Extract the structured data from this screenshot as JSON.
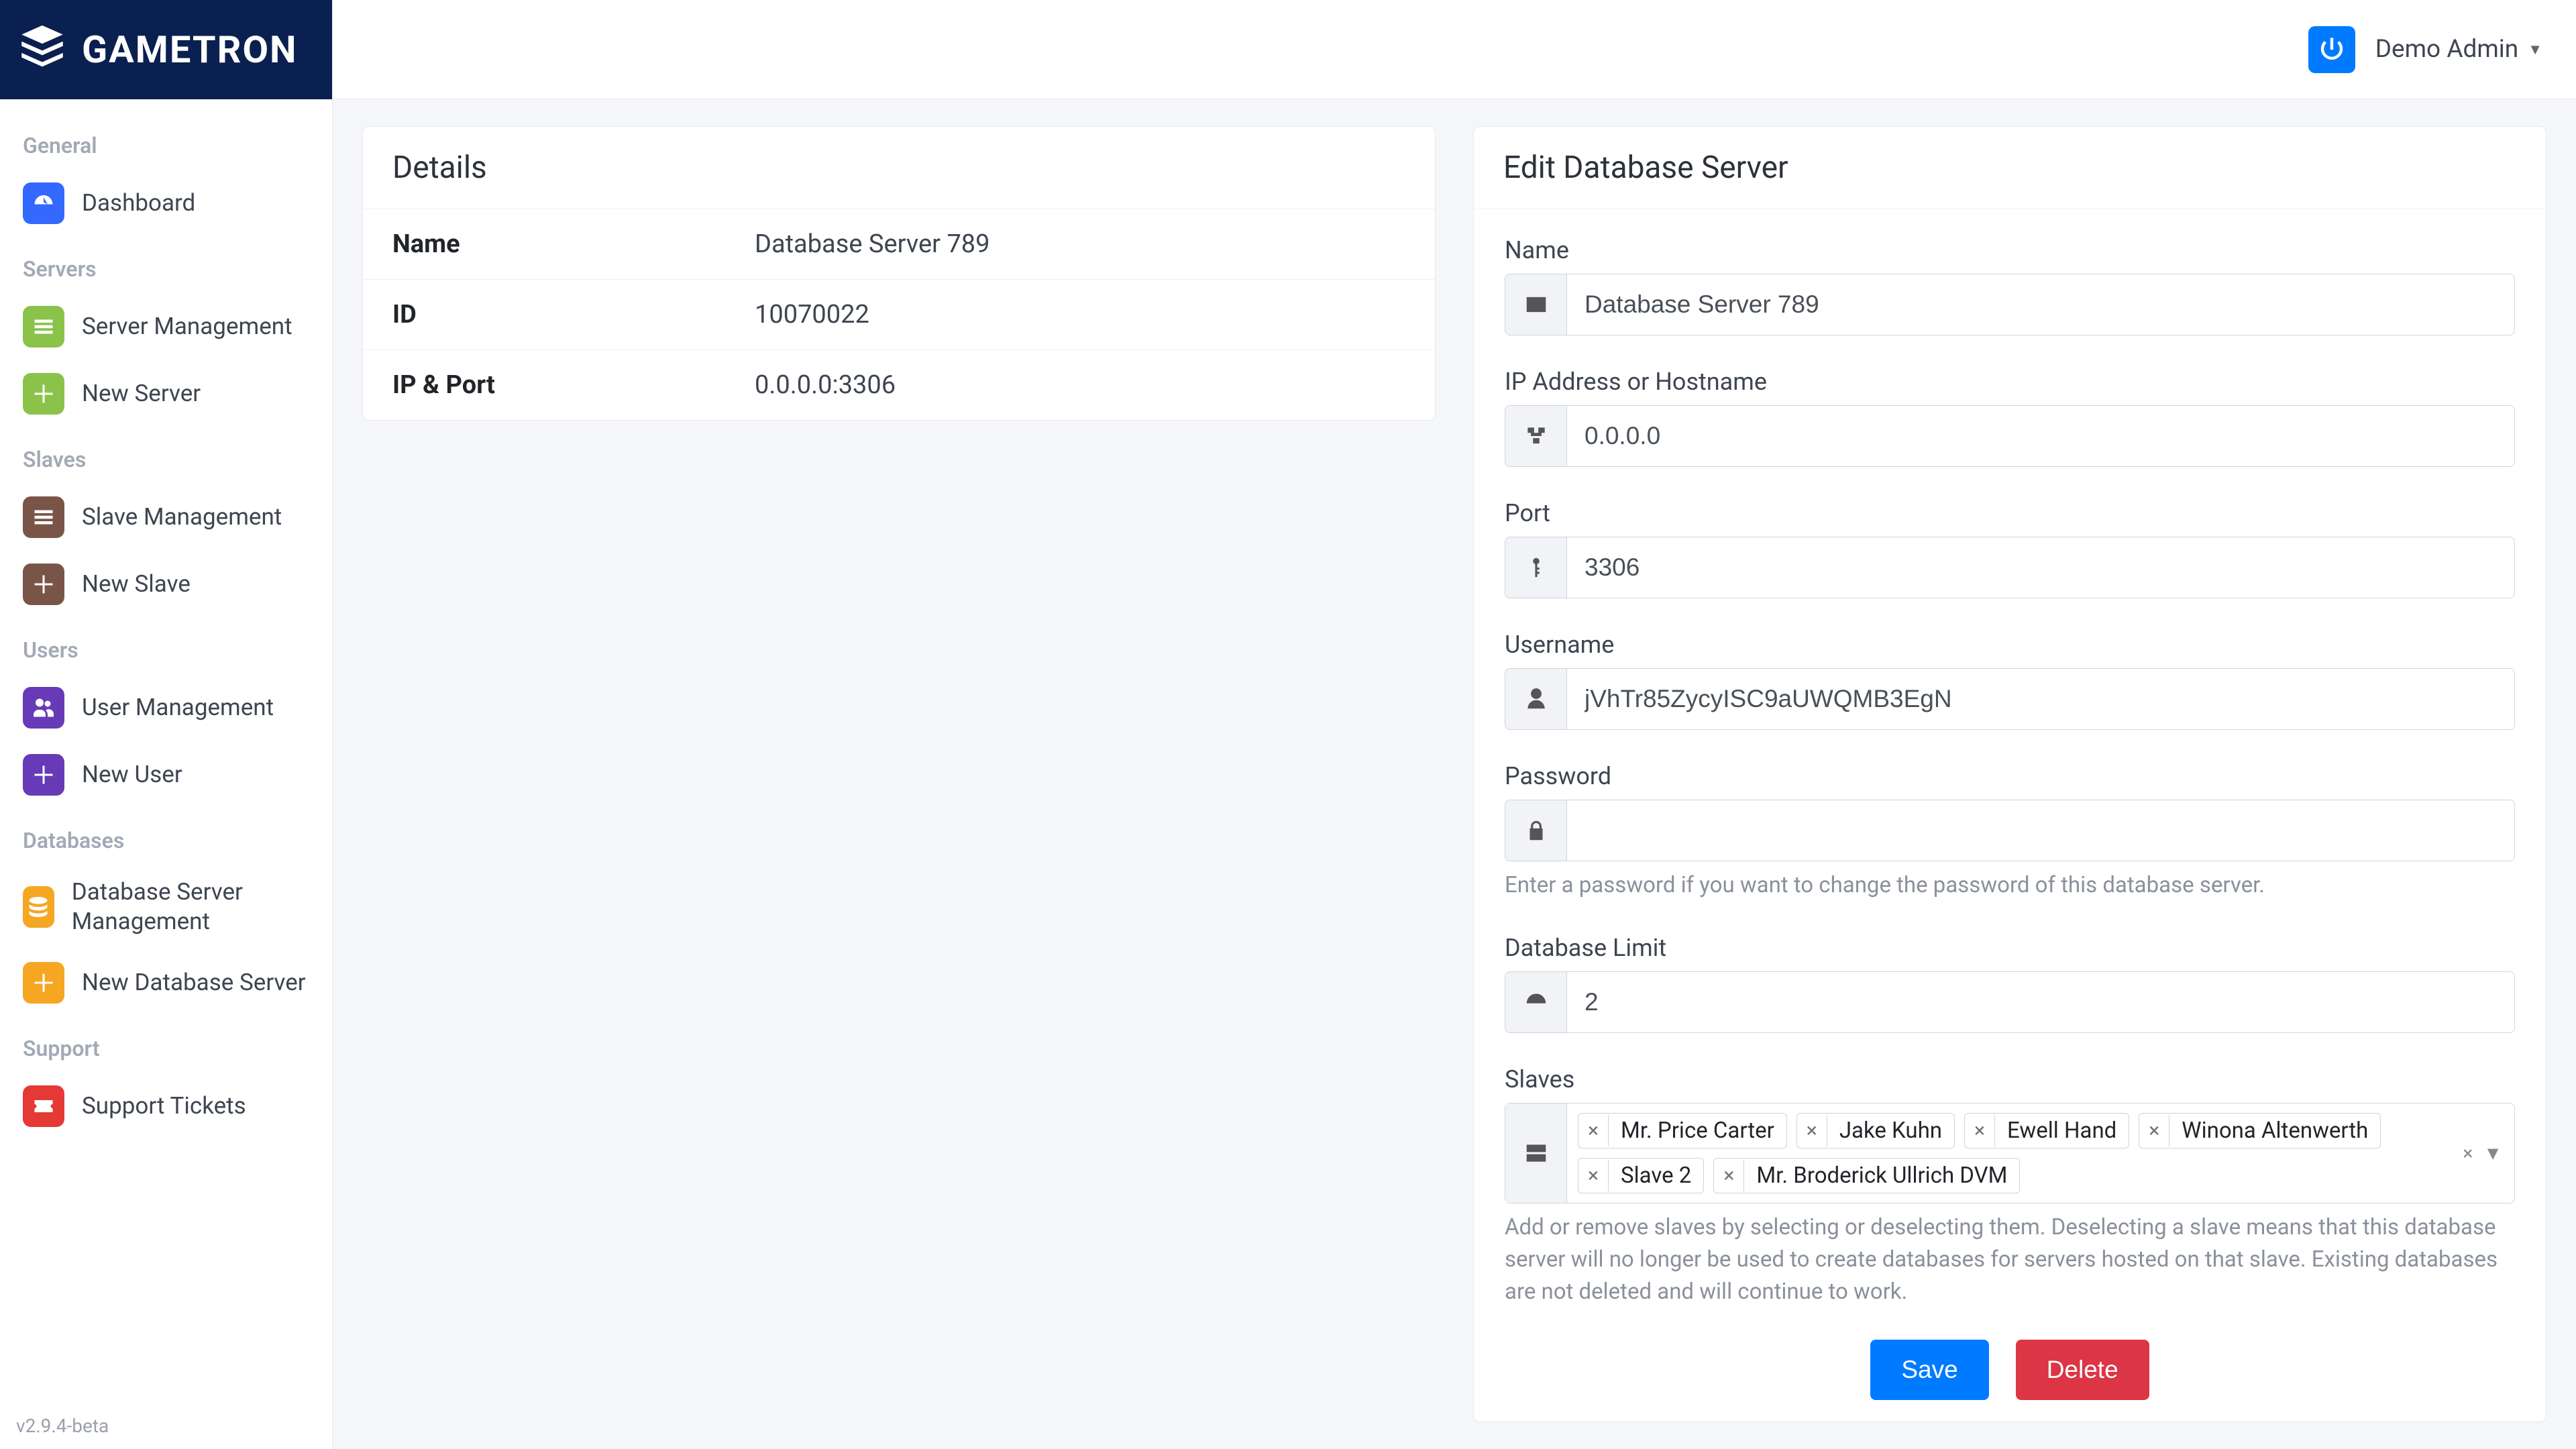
{
  "brand": {
    "name": "GAMETRON"
  },
  "topbar": {
    "user": "Demo Admin"
  },
  "version": "v2.9.4-beta",
  "sidebar": {
    "sections": [
      {
        "label": "General",
        "items": [
          {
            "label": "Dashboard",
            "color": "bg-blue",
            "icon": "dashboard"
          }
        ]
      },
      {
        "label": "Servers",
        "items": [
          {
            "label": "Server Management",
            "color": "bg-green",
            "icon": "list"
          },
          {
            "label": "New Server",
            "color": "bg-green2",
            "icon": "plus"
          }
        ]
      },
      {
        "label": "Slaves",
        "items": [
          {
            "label": "Slave Management",
            "color": "bg-brown",
            "icon": "list"
          },
          {
            "label": "New Slave",
            "color": "bg-brown2",
            "icon": "plus"
          }
        ]
      },
      {
        "label": "Users",
        "items": [
          {
            "label": "User Management",
            "color": "bg-purple",
            "icon": "users"
          },
          {
            "label": "New User",
            "color": "bg-purple2",
            "icon": "plus"
          }
        ]
      },
      {
        "label": "Databases",
        "items": [
          {
            "label": "Database Server Management",
            "color": "bg-orange",
            "icon": "database"
          },
          {
            "label": "New Database Server",
            "color": "bg-orange2",
            "icon": "plus"
          }
        ]
      },
      {
        "label": "Support",
        "items": [
          {
            "label": "Support Tickets",
            "color": "bg-red",
            "icon": "ticket"
          }
        ]
      }
    ]
  },
  "details": {
    "title": "Details",
    "rows": [
      {
        "key": "Name",
        "value": "Database Server 789"
      },
      {
        "key": "ID",
        "value": "10070022"
      },
      {
        "key": "IP & Port",
        "value": "0.0.0.0:3306"
      }
    ]
  },
  "form": {
    "title": "Edit Database Server",
    "name": {
      "label": "Name",
      "value": "Database Server 789"
    },
    "ip": {
      "label": "IP Address or Hostname",
      "value": "0.0.0.0"
    },
    "port": {
      "label": "Port",
      "value": "3306"
    },
    "username": {
      "label": "Username",
      "value": "jVhTr85ZycyISC9aUWQMB3EgN"
    },
    "password": {
      "label": "Password",
      "value": "",
      "help": "Enter a password if you want to change the password of this database server."
    },
    "db_limit": {
      "label": "Database Limit",
      "value": "2"
    },
    "slaves": {
      "label": "Slaves",
      "selected": [
        "Mr. Price Carter",
        "Jake Kuhn",
        "Ewell Hand",
        "Winona Altenwerth",
        "Slave 2",
        "Mr. Broderick Ullrich DVM"
      ],
      "help": "Add or remove slaves by selecting or deselecting them. Deselecting a slave means that this database server will no longer be used to create databases for servers hosted on that slave. Existing databases are not deleted and will continue to work."
    },
    "save_label": "Save",
    "delete_label": "Delete"
  }
}
